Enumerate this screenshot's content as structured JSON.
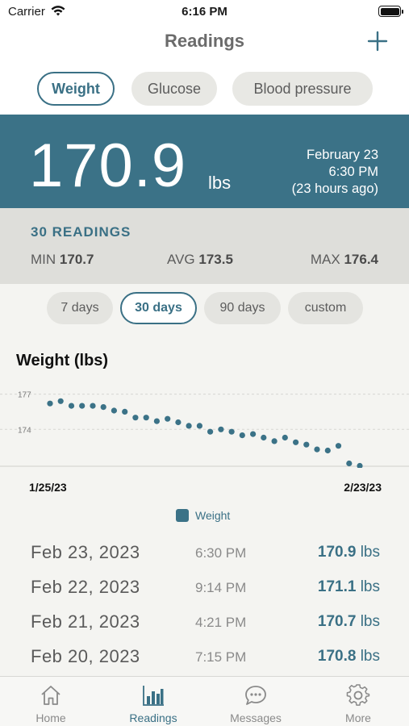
{
  "status_bar": {
    "carrier": "Carrier",
    "time": "6:16 PM"
  },
  "nav": {
    "title": "Readings",
    "add_icon": "plus-icon"
  },
  "type_tabs": [
    {
      "label": "Weight",
      "active": true
    },
    {
      "label": "Glucose",
      "active": false
    },
    {
      "label": "Blood pressure",
      "active": false
    }
  ],
  "latest": {
    "value": "170.9",
    "unit": "lbs",
    "date": "February 23",
    "time": "6:30 PM",
    "ago": "(23 hours ago)"
  },
  "summary": {
    "count_label": "30 READINGS",
    "min_label": "MIN",
    "min_value": "170.7",
    "avg_label": "AVG",
    "avg_value": "173.5",
    "max_label": "MAX",
    "max_value": "176.4"
  },
  "range_tabs": [
    {
      "label": "7 days",
      "active": false
    },
    {
      "label": "30 days",
      "active": true
    },
    {
      "label": "90 days",
      "active": false
    },
    {
      "label": "custom",
      "active": false
    }
  ],
  "chart_data": {
    "type": "scatter",
    "title": "Weight (lbs)",
    "x_start_label": "1/25/23",
    "x_end_label": "2/23/23",
    "y_ticks": [
      177,
      174
    ],
    "ylim": [
      171.0,
      178.0
    ],
    "legend": "Weight",
    "color": "#3b7287",
    "x": [
      "1/25",
      "1/26",
      "1/27",
      "1/28",
      "1/29",
      "1/30",
      "1/31",
      "2/1",
      "2/2",
      "2/3",
      "2/4",
      "2/5",
      "2/6",
      "2/7",
      "2/8",
      "2/9",
      "2/10",
      "2/11",
      "2/12",
      "2/13",
      "2/14",
      "2/15",
      "2/16",
      "2/17",
      "2/18",
      "2/19",
      "2/20",
      "2/21",
      "2/22",
      "2/23"
    ],
    "values": [
      176.2,
      176.4,
      176.0,
      176.0,
      176.0,
      175.9,
      175.6,
      175.5,
      175.0,
      175.0,
      174.7,
      174.9,
      174.6,
      174.3,
      174.3,
      173.8,
      174.0,
      173.8,
      173.5,
      173.6,
      173.3,
      173.0,
      173.3,
      172.9,
      172.7,
      172.3,
      172.2,
      172.6,
      171.1,
      170.9
    ]
  },
  "readings": [
    {
      "date": "Feb 23, 2023",
      "time": "6:30 PM",
      "value": "170.9",
      "unit": "lbs"
    },
    {
      "date": "Feb 22, 2023",
      "time": "9:14 PM",
      "value": "171.1",
      "unit": "lbs"
    },
    {
      "date": "Feb 21, 2023",
      "time": "4:21 PM",
      "value": "170.7",
      "unit": "lbs"
    },
    {
      "date": "Feb 20, 2023",
      "time": "7:15 PM",
      "value": "170.8",
      "unit": "lbs"
    }
  ],
  "tab_bar": [
    {
      "label": "Home",
      "icon": "home-icon",
      "active": false
    },
    {
      "label": "Readings",
      "icon": "bar-chart-icon",
      "active": true
    },
    {
      "label": "Messages",
      "icon": "chat-bubble-icon",
      "active": false
    },
    {
      "label": "More",
      "icon": "gear-icon",
      "active": false
    }
  ]
}
